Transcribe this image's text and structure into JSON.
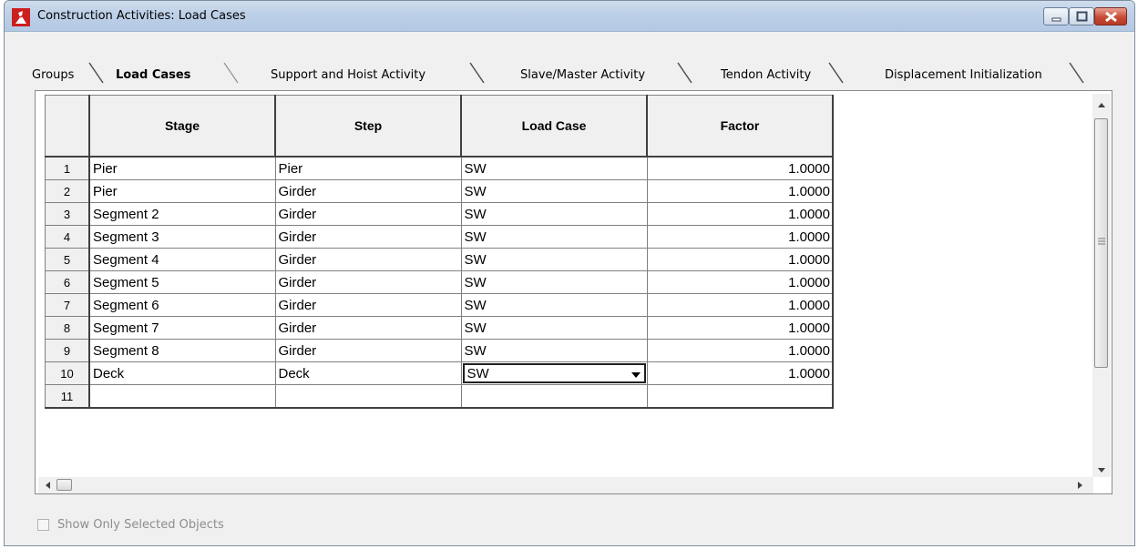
{
  "window": {
    "title": "Construction Activities: Load Cases",
    "controls": [
      "minimize-icon",
      "maximize-icon",
      "close-icon"
    ]
  },
  "tabs": [
    {
      "label": "Groups",
      "active": false
    },
    {
      "label": "Load Cases",
      "active": true
    },
    {
      "label": "Support and Hoist Activity",
      "active": false
    },
    {
      "label": "Slave/Master Activity",
      "active": false
    },
    {
      "label": "Tendon Activity",
      "active": false
    },
    {
      "label": "Displacement Initialization",
      "active": false
    }
  ],
  "grid": {
    "columns": [
      "Stage",
      "Step",
      "Load Case",
      "Factor"
    ],
    "rows": [
      {
        "num": "1",
        "stage": "Pier",
        "step": "Pier",
        "load_case": "SW",
        "factor": "1.0000"
      },
      {
        "num": "2",
        "stage": "Pier",
        "step": "Girder",
        "load_case": "SW",
        "factor": "1.0000"
      },
      {
        "num": "3",
        "stage": "Segment 2",
        "step": "Girder",
        "load_case": "SW",
        "factor": "1.0000"
      },
      {
        "num": "4",
        "stage": "Segment 3",
        "step": "Girder",
        "load_case": "SW",
        "factor": "1.0000"
      },
      {
        "num": "5",
        "stage": "Segment 4",
        "step": "Girder",
        "load_case": "SW",
        "factor": "1.0000"
      },
      {
        "num": "6",
        "stage": "Segment 5",
        "step": "Girder",
        "load_case": "SW",
        "factor": "1.0000"
      },
      {
        "num": "7",
        "stage": "Segment 6",
        "step": "Girder",
        "load_case": "SW",
        "factor": "1.0000"
      },
      {
        "num": "8",
        "stage": "Segment 7",
        "step": "Girder",
        "load_case": "SW",
        "factor": "1.0000"
      },
      {
        "num": "9",
        "stage": "Segment 8",
        "step": "Girder",
        "load_case": "SW",
        "factor": "1.0000"
      },
      {
        "num": "10",
        "stage": "Deck",
        "step": "Deck",
        "load_case": "SW",
        "factor": "1.0000"
      },
      {
        "num": "11",
        "stage": "",
        "step": "",
        "load_case": "",
        "factor": ""
      }
    ],
    "editing": {
      "row_num": "10",
      "column": "Load Case",
      "value": "SW"
    }
  },
  "footer": {
    "show_selected_label": "Show Only Selected Objects",
    "show_selected_checked": false
  },
  "colors": {
    "titlebar": "#bdd0e8",
    "close_button": "#c94a35",
    "app_icon": "#cc1f1f"
  }
}
